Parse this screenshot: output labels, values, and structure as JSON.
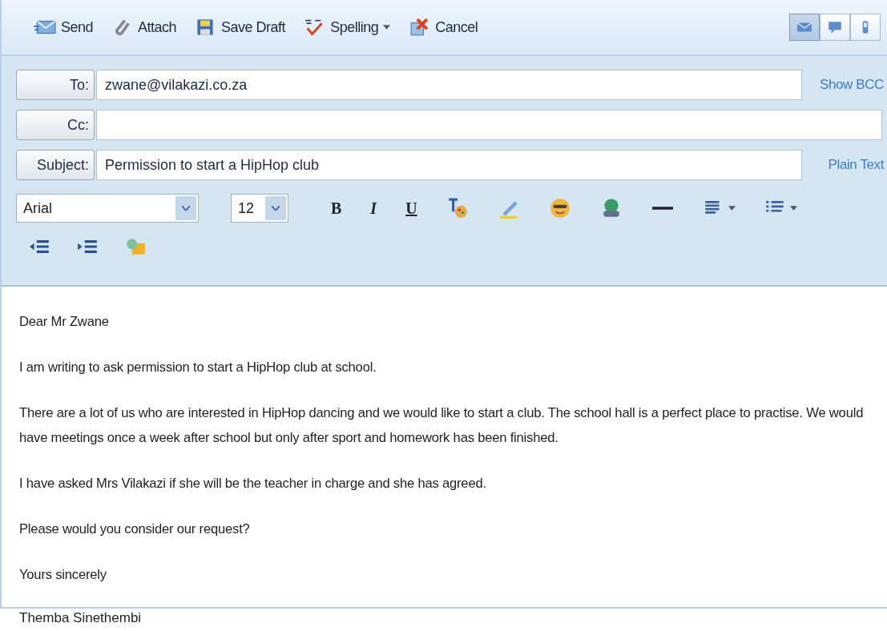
{
  "toolbar": {
    "buttons": [
      {
        "kind": "send",
        "label": "Send"
      },
      {
        "kind": "attach",
        "label": "Attach"
      },
      {
        "kind": "save",
        "label": "Save Draft"
      },
      {
        "kind": "spelling",
        "label": "Spelling",
        "dropdown": true
      },
      {
        "kind": "cancel",
        "label": "Cancel"
      }
    ],
    "views": [
      {
        "kind": "mail",
        "selected": true
      },
      {
        "kind": "chat",
        "selected": false
      },
      {
        "kind": "phone",
        "selected": false
      }
    ]
  },
  "fields": [
    {
      "label": "To:",
      "value": "zwane@vilakazi.co.za",
      "link": "Show BCC"
    },
    {
      "label": "Cc:"
    },
    {
      "label": "Subject:",
      "value": "Permission to start a HipHop club",
      "link": "Plain Text"
    }
  ],
  "format": {
    "font": "Arial",
    "size": "12",
    "buttons": [
      {
        "kind": "bold",
        "label": "B"
      },
      {
        "kind": "italic",
        "label": "I"
      },
      {
        "kind": "underline",
        "label": "U"
      },
      {
        "kind": "text-color"
      },
      {
        "kind": "highlight"
      },
      {
        "kind": "emoticon"
      },
      {
        "kind": "globe"
      },
      {
        "kind": "rule"
      },
      {
        "kind": "align",
        "dropdown": true
      },
      {
        "kind": "list",
        "dropdown": true
      }
    ],
    "second_row": [
      {
        "kind": "outdent"
      },
      {
        "kind": "indent"
      },
      {
        "kind": "image"
      }
    ]
  },
  "body": {
    "paragraphs": [
      "Dear Mr Zwane",
      "I am writing to ask permission to start a HipHop club at school.",
      "There are a lot of us who are interested in HipHop dancing and we would like to start a club. The school hall is a perfect place to practise. We would have meetings once a week after school but only after sport and homework has been finished.",
      "I have asked Mrs Vilakazi if she will be the teacher in charge and she has agreed.",
      "Please would you consider our request?"
    ],
    "closing": "Yours sincerely",
    "signature": "Themba Sinethembi"
  }
}
